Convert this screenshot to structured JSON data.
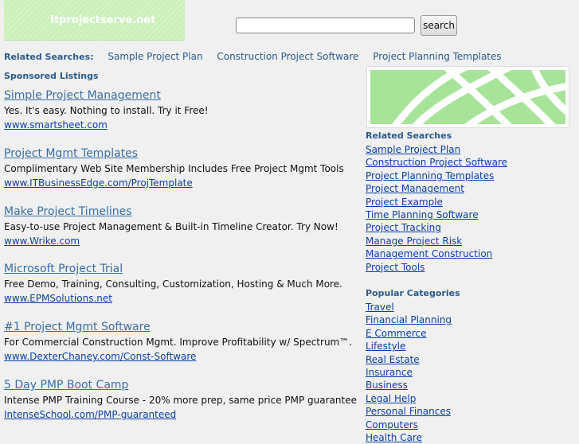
{
  "header": {
    "logo_text": "Itprojectserve.net",
    "search_value": "",
    "search_button": "search"
  },
  "top_related": {
    "label": "Related Searches:",
    "items": [
      "Sample Project Plan",
      "Construction Project Software",
      "Project Planning Templates"
    ]
  },
  "sponsored_label": "Sponsored Listings",
  "ads": [
    {
      "title": "Simple Project Management",
      "desc": "Yes. It's easy. Nothing to install. Try it Free!",
      "url": "www.smartsheet.com"
    },
    {
      "title": "Project Mgmt Templates",
      "desc": "Complimentary Web Site Membership Includes Free Project Mgmt Tools",
      "url": "www.ITBusinessEdge.com/ProjTemplate"
    },
    {
      "title": "Make Project Timelines",
      "desc": "Easy-to-use Project Management & Built-in Timeline Creator. Try Now!",
      "url": "www.Wrike.com"
    },
    {
      "title": "Microsoft Project Trial",
      "desc": "Free Demo, Training, Consulting, Customization, Hosting & Much More.",
      "url": "www.EPMSolutions.net"
    },
    {
      "title": "#1 Project Mgmt Software",
      "desc": "For Commercial Construction Mgmt. Improve Profitability w/ Spectrum™.",
      "url": "www.DexterChaney.com/Const-Software"
    },
    {
      "title": "5 Day PMP Boot Camp",
      "desc": "Intense PMP Training Course - 20% more prep, same price PMP guarantee",
      "url": "IntenseSchool.com/PMP-guaranteed"
    }
  ],
  "side_related": {
    "heading": "Related Searches",
    "items": [
      "Sample Project Plan",
      "Construction Project Software",
      "Project Planning Templates",
      "Project Management",
      "Project Example",
      "Time Planning Software",
      "Project Tracking",
      "Manage Project Risk",
      "Management Construction",
      "Project Tools"
    ]
  },
  "side_popular": {
    "heading": "Popular Categories",
    "items": [
      "Travel",
      "Financial Planning",
      "E Commerce",
      "Lifestyle",
      "Real Estate",
      "Insurance",
      "Business",
      "Legal Help",
      "Personal Finances",
      "Computers",
      "Health Care"
    ]
  },
  "colors": {
    "logo_bg": "#c9f0b8",
    "heading": "#2b5a8f",
    "link": "#0a3fa8",
    "ad_title": "#3a6ea8"
  }
}
